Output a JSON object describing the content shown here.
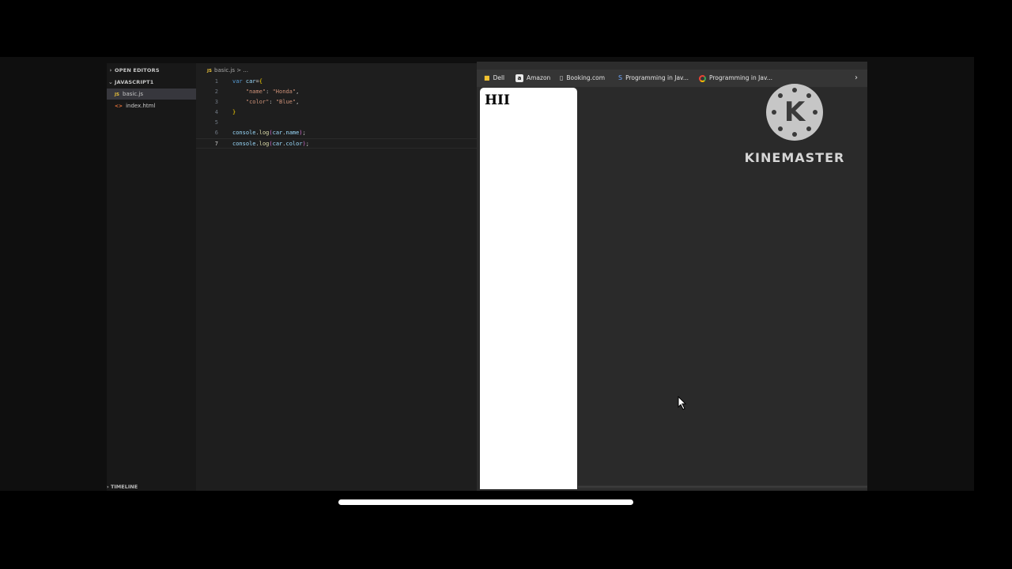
{
  "sidebar": {
    "open_editors": "OPEN EDITORS",
    "folder": "JAVASCRIPT1",
    "files": [
      {
        "icon": "JS",
        "name": "basic.js"
      },
      {
        "icon": "<>",
        "name": "index.html"
      }
    ],
    "timeline": "TIMELINE"
  },
  "editor": {
    "breadcrumb_icon": "JS",
    "breadcrumb": "basic.js > ..."
  },
  "browser": {
    "bookmarks": [
      {
        "icon": "folder-icon",
        "label": "Dell"
      },
      {
        "icon": "amazon-icon",
        "label": "Amazon"
      },
      {
        "icon": "page-icon",
        "label": "Booking.com"
      },
      {
        "icon": "bookmark-icon",
        "label": "Programming in Jav..."
      },
      {
        "icon": "google-icon",
        "label": "Programming in Jav..."
      }
    ],
    "page_heading": "HII"
  },
  "watermark": {
    "letter": "K",
    "text": "KINEMASTER"
  },
  "colors": {
    "editor_bg": "#1e1e1e",
    "sidebar_bg": "#181818",
    "keyword": "#569cd6",
    "string": "#ce9178",
    "function": "#dcdcaa"
  }
}
